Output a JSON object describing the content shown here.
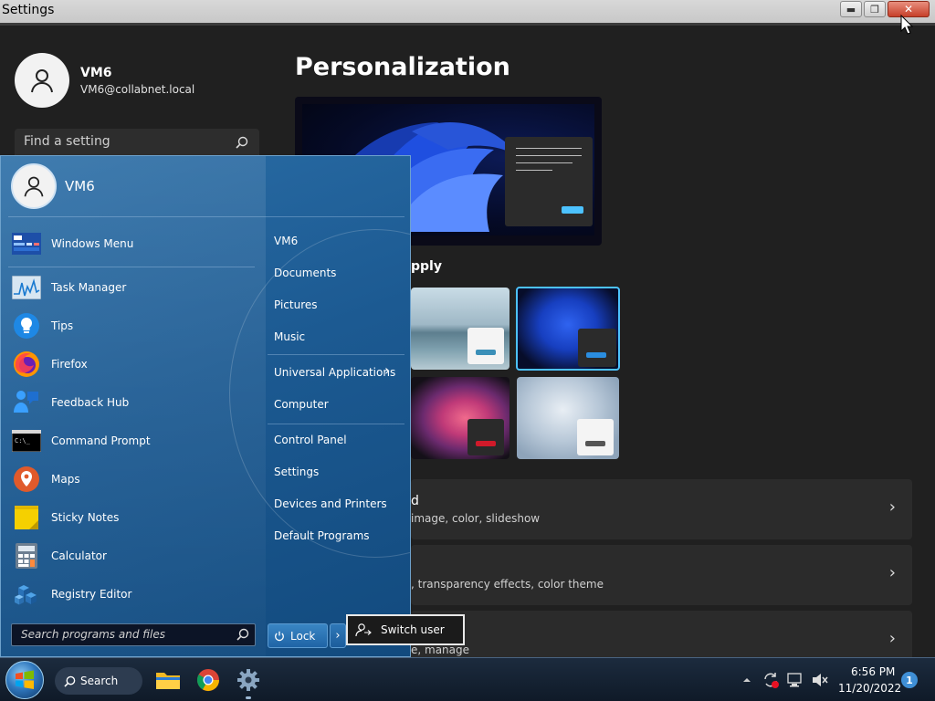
{
  "window": {
    "title": "Settings",
    "minimize_glyph": "▬",
    "restore_glyph": "❐",
    "close_glyph": "✕"
  },
  "settings": {
    "user": {
      "name": "VM6",
      "email": "VM6@collabnet.local"
    },
    "search_placeholder": "Find a setting",
    "page_title": "Personalization",
    "theme_heading_visible_fragment": "pply",
    "rows": [
      {
        "title_visible_fragment": "d",
        "subtitle_visible_fragment": "image, color, slideshow"
      },
      {
        "title_visible_fragment": "",
        "subtitle_visible_fragment": ", transparency effects, color theme"
      },
      {
        "title_visible_fragment": "",
        "subtitle_visible_fragment": "e, manage"
      }
    ],
    "row_chevron": "›",
    "colors": {
      "accent": "#4cc2ff",
      "background": "#202020",
      "card": "#2b2b2b"
    }
  },
  "start_menu": {
    "user": "VM6",
    "programs": [
      {
        "label": "Windows Menu",
        "icon": "windows-menu-icon"
      },
      {
        "label": "Task Manager",
        "icon": "task-manager-icon"
      },
      {
        "label": "Tips",
        "icon": "tips-icon"
      },
      {
        "label": "Firefox",
        "icon": "firefox-icon"
      },
      {
        "label": "Feedback Hub",
        "icon": "feedback-hub-icon"
      },
      {
        "label": "Command Prompt",
        "icon": "command-prompt-icon"
      },
      {
        "label": "Maps",
        "icon": "maps-icon"
      },
      {
        "label": "Sticky Notes",
        "icon": "sticky-notes-icon"
      },
      {
        "label": "Calculator",
        "icon": "calculator-icon"
      },
      {
        "label": "Registry Editor",
        "icon": "registry-editor-icon"
      }
    ],
    "places": [
      "VM6",
      "Documents",
      "Pictures",
      "Music",
      "Universal Applications",
      "Computer",
      "Control Panel",
      "Settings",
      "Devices and Printers",
      "Default Programs"
    ],
    "search_placeholder": "Search programs and files",
    "lock_label": "Lock",
    "lock_arrow": "›",
    "submenu_chevron": "›"
  },
  "power_popup": {
    "label": "Switch user"
  },
  "taskbar": {
    "search_label": "Search",
    "apps": [
      "file-explorer-icon",
      "chrome-icon",
      "settings-gear-icon"
    ],
    "clock_time": "6:56 PM",
    "clock_date": "11/20/2022",
    "notification_count": "1"
  }
}
